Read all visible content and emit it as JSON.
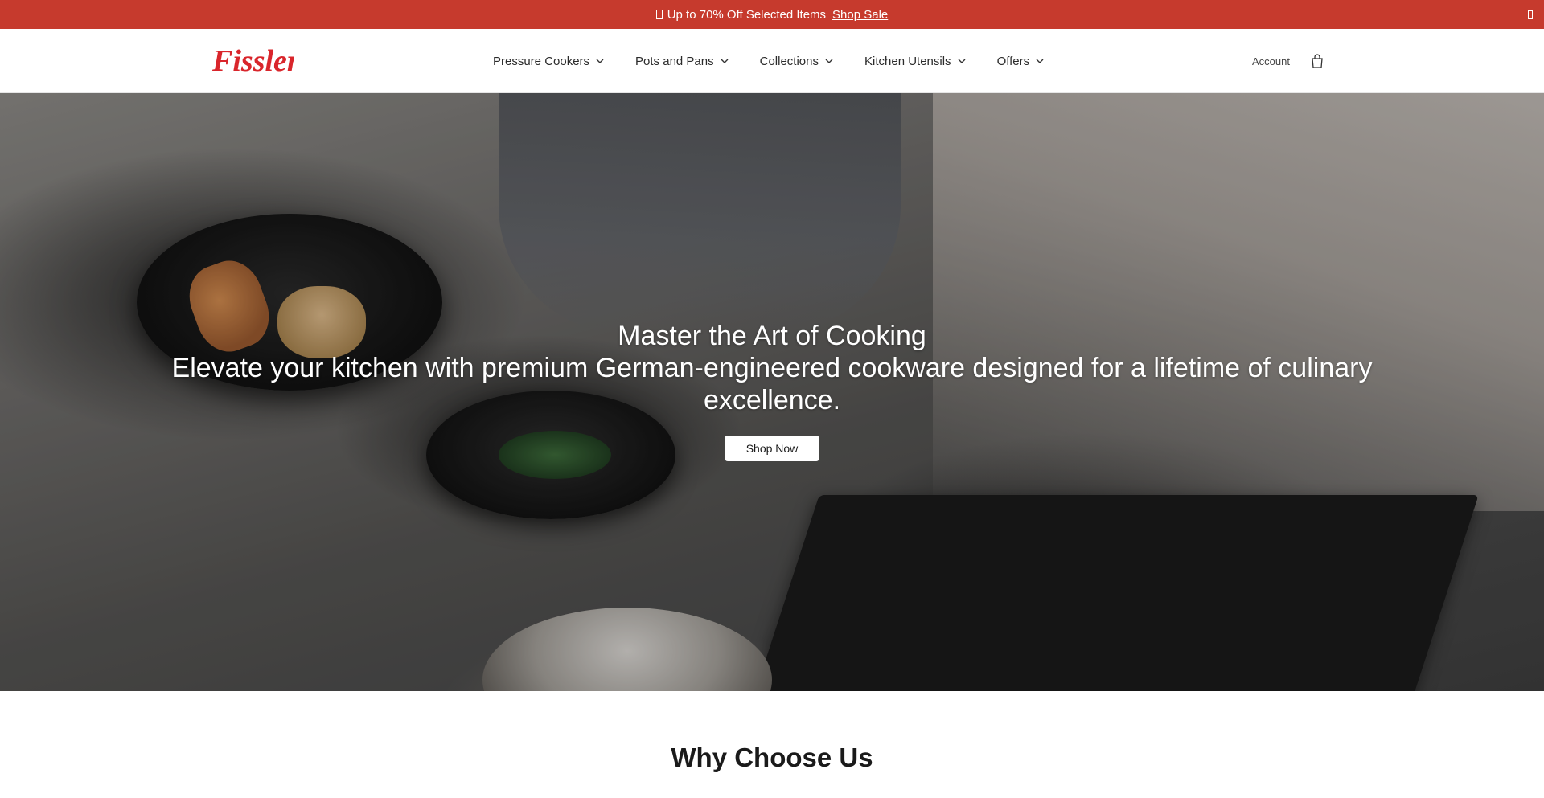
{
  "announcement": {
    "text": "Up to 70% Off Selected Items",
    "link": "Shop Sale"
  },
  "brand": {
    "logo_text": "Fissler",
    "logo_color": "#d9252b"
  },
  "nav": {
    "items": [
      {
        "label": "Pressure Cookers"
      },
      {
        "label": "Pots and Pans"
      },
      {
        "label": "Collections"
      },
      {
        "label": "Kitchen Utensils"
      },
      {
        "label": "Offers"
      }
    ]
  },
  "header": {
    "account_label": "Account"
  },
  "hero": {
    "title": "Master the Art of Cooking",
    "subtitle": "Elevate your kitchen with premium German-engineered cookware designed for a lifetime of culinary excellence.",
    "cta_label": "Shop Now"
  },
  "sections": {
    "why_title": "Why Choose Us"
  },
  "colors": {
    "announcement_bg": "#c63a2d",
    "cta_bg": "#ffffff"
  }
}
